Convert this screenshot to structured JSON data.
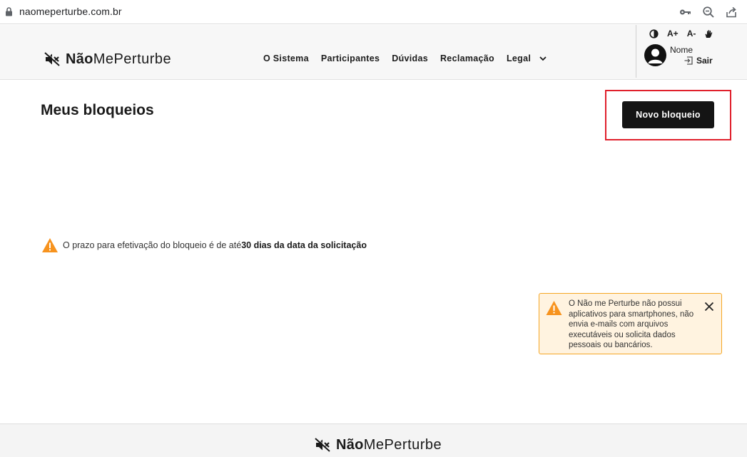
{
  "browser": {
    "url": "naomeperturbe.com.br",
    "tools": [
      "key-icon",
      "zoom-icon",
      "share-icon"
    ]
  },
  "header": {
    "logo": {
      "bold": "Não",
      "light": "MePerturbe"
    },
    "nav": [
      {
        "label": "O Sistema"
      },
      {
        "label": "Participantes"
      },
      {
        "label": "Dúvidas"
      },
      {
        "label": "Reclamação"
      },
      {
        "label": "Legal"
      }
    ],
    "accessibility": {
      "font_increase": "A+",
      "font_decrease": "A-"
    },
    "user": {
      "name": "Nome",
      "logout": "Sair"
    }
  },
  "main": {
    "title": "Meus bloqueios",
    "new_button": "Novo bloqueio",
    "notice": {
      "text": "O prazo para efetivação do bloqueio é de até ",
      "strong": "30 dias da data da solicitação"
    }
  },
  "toast": {
    "message": "O Não me Perturbe não possui aplicativos para smartphones, não envia e-mails com arquivos executáveis ou solicita dados pessoais ou bancários."
  },
  "footer": {
    "logo": {
      "bold": "Não",
      "light": "MePerturbe"
    }
  },
  "colors": {
    "highlight": "#e0202c",
    "warning": "#f7931e",
    "button": "#141414",
    "toast_bg": "#fff3e0"
  }
}
